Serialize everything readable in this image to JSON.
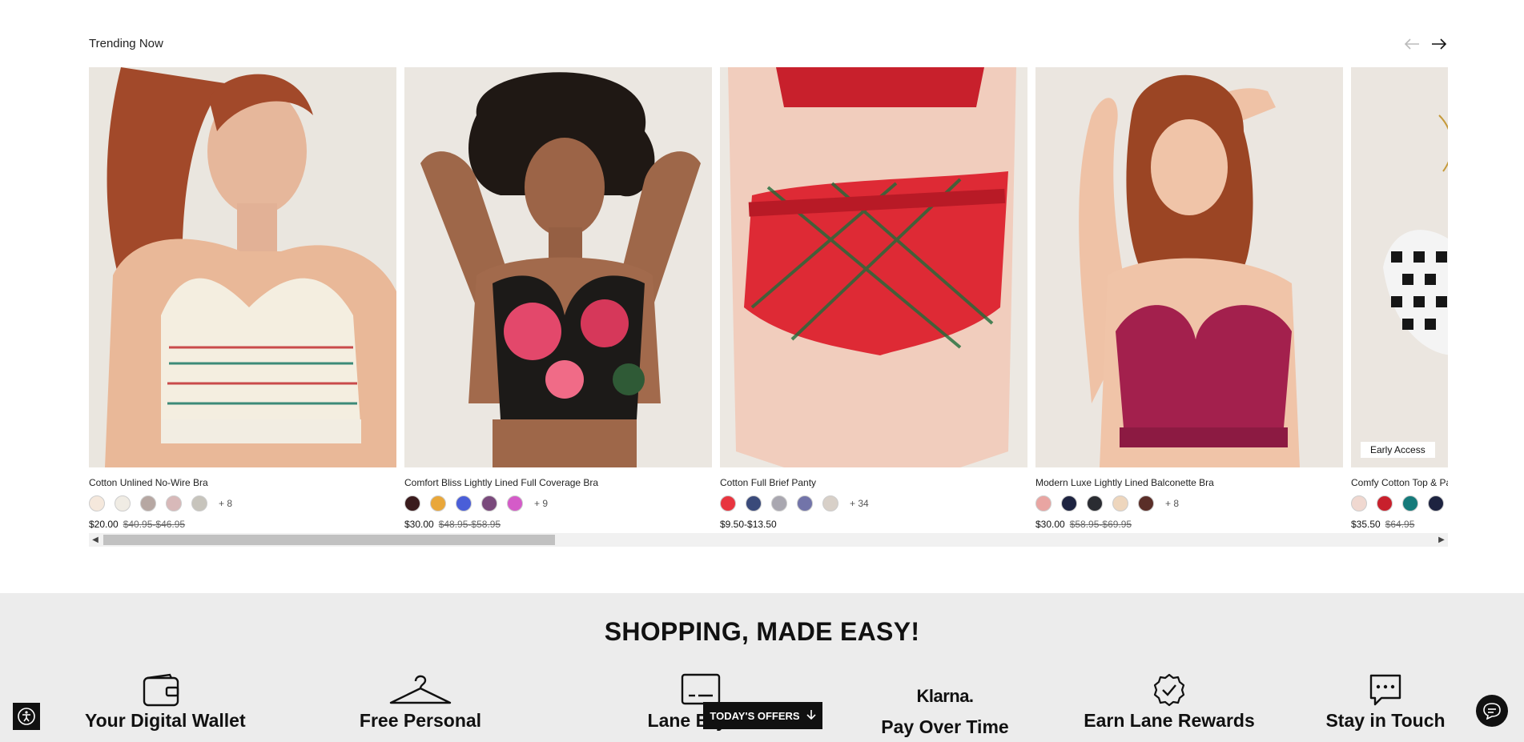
{
  "trending": {
    "title": "Trending Now",
    "prev_label": "previous",
    "next_label": "next",
    "products": [
      {
        "name": "Cotton Unlined No-Wire Bra",
        "swatches": [
          "#f5e8dc",
          "#f0ece4",
          "#b6a7a2",
          "#d8b9b9",
          "#c7c4bc"
        ],
        "more": "+ 8",
        "price": "$20.00",
        "old_price": "$40.95-$46.95"
      },
      {
        "name": "Comfort Bliss Lightly Lined Full Coverage Bra",
        "swatches": [
          "#3a1b1d",
          "#e9a73a",
          "#4a5ed8",
          "#7a4a7c",
          "#d45bc8"
        ],
        "more": "+ 9",
        "price": "$30.00",
        "old_price": "$48.95-$58.95"
      },
      {
        "name": "Cotton Full Brief Panty",
        "swatches": [
          "#e8353f",
          "#3a4a7a",
          "#a9a7b0",
          "#7274a9",
          "#d8d0c8"
        ],
        "more": "+ 34",
        "price": "$9.50-$13.50",
        "old_price": ""
      },
      {
        "name": "Modern Luxe Lightly Lined Balconette Bra",
        "swatches": [
          "#e9a5a2",
          "#1d2340",
          "#2a2c32",
          "#eed6bd",
          "#5a2e28"
        ],
        "more": "+ 8",
        "price": "$30.00",
        "old_price": "$58.95-$69.95"
      },
      {
        "name": "Comfy Cotton Top & Pa",
        "swatches": [
          "#f0d8d0",
          "#c8202c",
          "#157a7a",
          "#1d2340"
        ],
        "more": "",
        "price": "$35.50",
        "old_price": "$64.95",
        "badge": "Early Access"
      }
    ]
  },
  "shopping": {
    "title": "SHOPPING, MADE EASY!",
    "features": [
      {
        "label": "Your Digital Wallet",
        "icon": "wallet-icon"
      },
      {
        "label": "Free Personal",
        "icon": "hanger-icon"
      },
      {
        "label": "Lane Bryant",
        "icon": "card-icon"
      },
      {
        "label": "Pay Over Time",
        "icon": "klarna-logo",
        "logo_text": "Klarna."
      },
      {
        "label": "Earn Lane Rewards",
        "icon": "badge-check-icon"
      },
      {
        "label": "Stay in Touch",
        "icon": "message-icon"
      }
    ]
  },
  "offers_button": "TODAY'S OFFERS",
  "colors": {
    "accent": "#111111",
    "panel": "#ececec"
  }
}
